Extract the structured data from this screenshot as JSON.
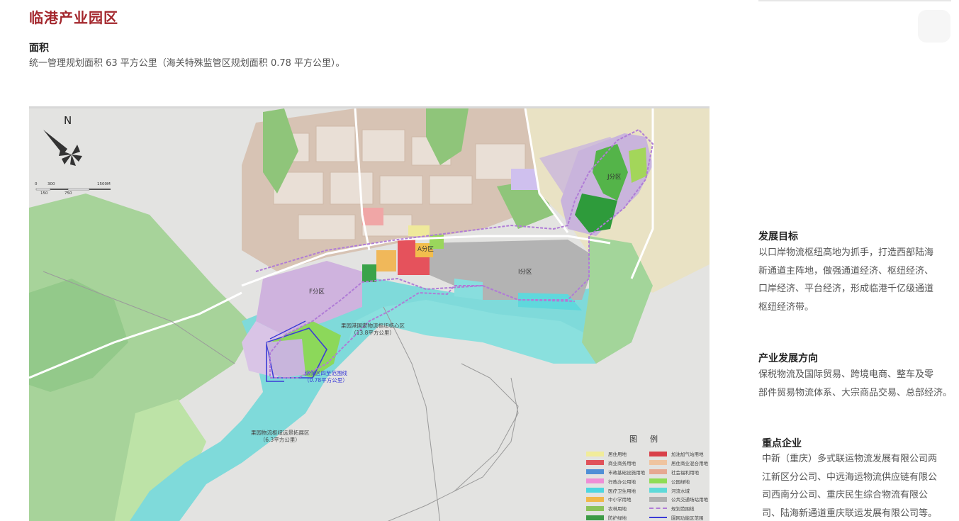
{
  "page": {
    "title": "临港产业园区"
  },
  "area": {
    "heading": "面积",
    "text": "统一管理规划面积 63 平方公里（海关特殊监管区规划面积 0.78 平方公里）。"
  },
  "goal": {
    "heading": "发展目标",
    "lines": [
      "以口岸物流枢纽高地为抓手，打造西部陆海",
      "新通道主阵地，做强通道经济、枢纽经济、",
      "口岸经济、平台经济，形成临港千亿级通道",
      "枢纽经济带。"
    ]
  },
  "direction": {
    "heading": "产业发展方向",
    "lines": [
      "保税物流及国际贸易、跨境电商、整车及零",
      "部件贸易物流体系、大宗商品交易、总部经济。"
    ]
  },
  "enterprises": {
    "heading": "重点企业",
    "lines": [
      "中新（重庆）多式联运物流发展有限公司两",
      "江新区分公司、中远海运物流供应链有限公",
      "司西南分公司、重庆民生综合物流有限公",
      "司、陆海新通道重庆联运发展有限公司等。"
    ]
  },
  "map": {
    "north": "N",
    "scale": {
      "top": [
        "0",
        "300",
        "1500M"
      ],
      "bottom": [
        "150",
        "750"
      ]
    },
    "zones": {
      "A": "A分区",
      "F": "F分区",
      "I": "I分区",
      "J": "J分区"
    },
    "core_label": {
      "name": "果园港国家物流枢纽核心区",
      "area": "（13.8平方公里）"
    },
    "bonded_label": {
      "name": "综保区四至范围线",
      "area": "（0.78平方公里）"
    },
    "expansion_label": {
      "name": "果园物流枢纽远景拓展区",
      "area": "（6.3平方公里）"
    },
    "legend_title": "图例",
    "legend": [
      {
        "label": "居住用地",
        "color": "#f1ec9a",
        "style": "fill"
      },
      {
        "label": "加油加气站用地",
        "color": "#d9404a",
        "style": "fill"
      },
      {
        "label": "商业商务用地",
        "color": "#e0525a",
        "style": "fill"
      },
      {
        "label": "居住商业混合用地",
        "color": "#efc4a0",
        "style": "fill"
      },
      {
        "label": "市政基础设施用地",
        "color": "#4f8fd6",
        "style": "fill"
      },
      {
        "label": "社会福利用地",
        "color": "#e6a892",
        "style": "fill"
      },
      {
        "label": "行政办公用地",
        "color": "#ee8ed6",
        "style": "fill"
      },
      {
        "label": "公园绿地",
        "color": "#8fdc55",
        "style": "fill"
      },
      {
        "label": "医疗卫生用地",
        "color": "#4dd6e0",
        "style": "fill"
      },
      {
        "label": "河流水域",
        "color": "#5edad9",
        "style": "fill"
      },
      {
        "label": "中小学用地",
        "color": "#f0b84a",
        "style": "fill"
      },
      {
        "label": "公共交通场站用地",
        "color": "#b0b0b0",
        "style": "fill"
      },
      {
        "label": "农林用地",
        "color": "#8ac35a",
        "style": "fill"
      },
      {
        "label": "规划范围线",
        "color": "#b07cd6",
        "style": "dash"
      },
      {
        "label": "防护绿地",
        "color": "#3c9a45",
        "style": "fill"
      },
      {
        "label": "園网功能区范围",
        "color": "#3b3bd6",
        "style": "line"
      }
    ]
  }
}
